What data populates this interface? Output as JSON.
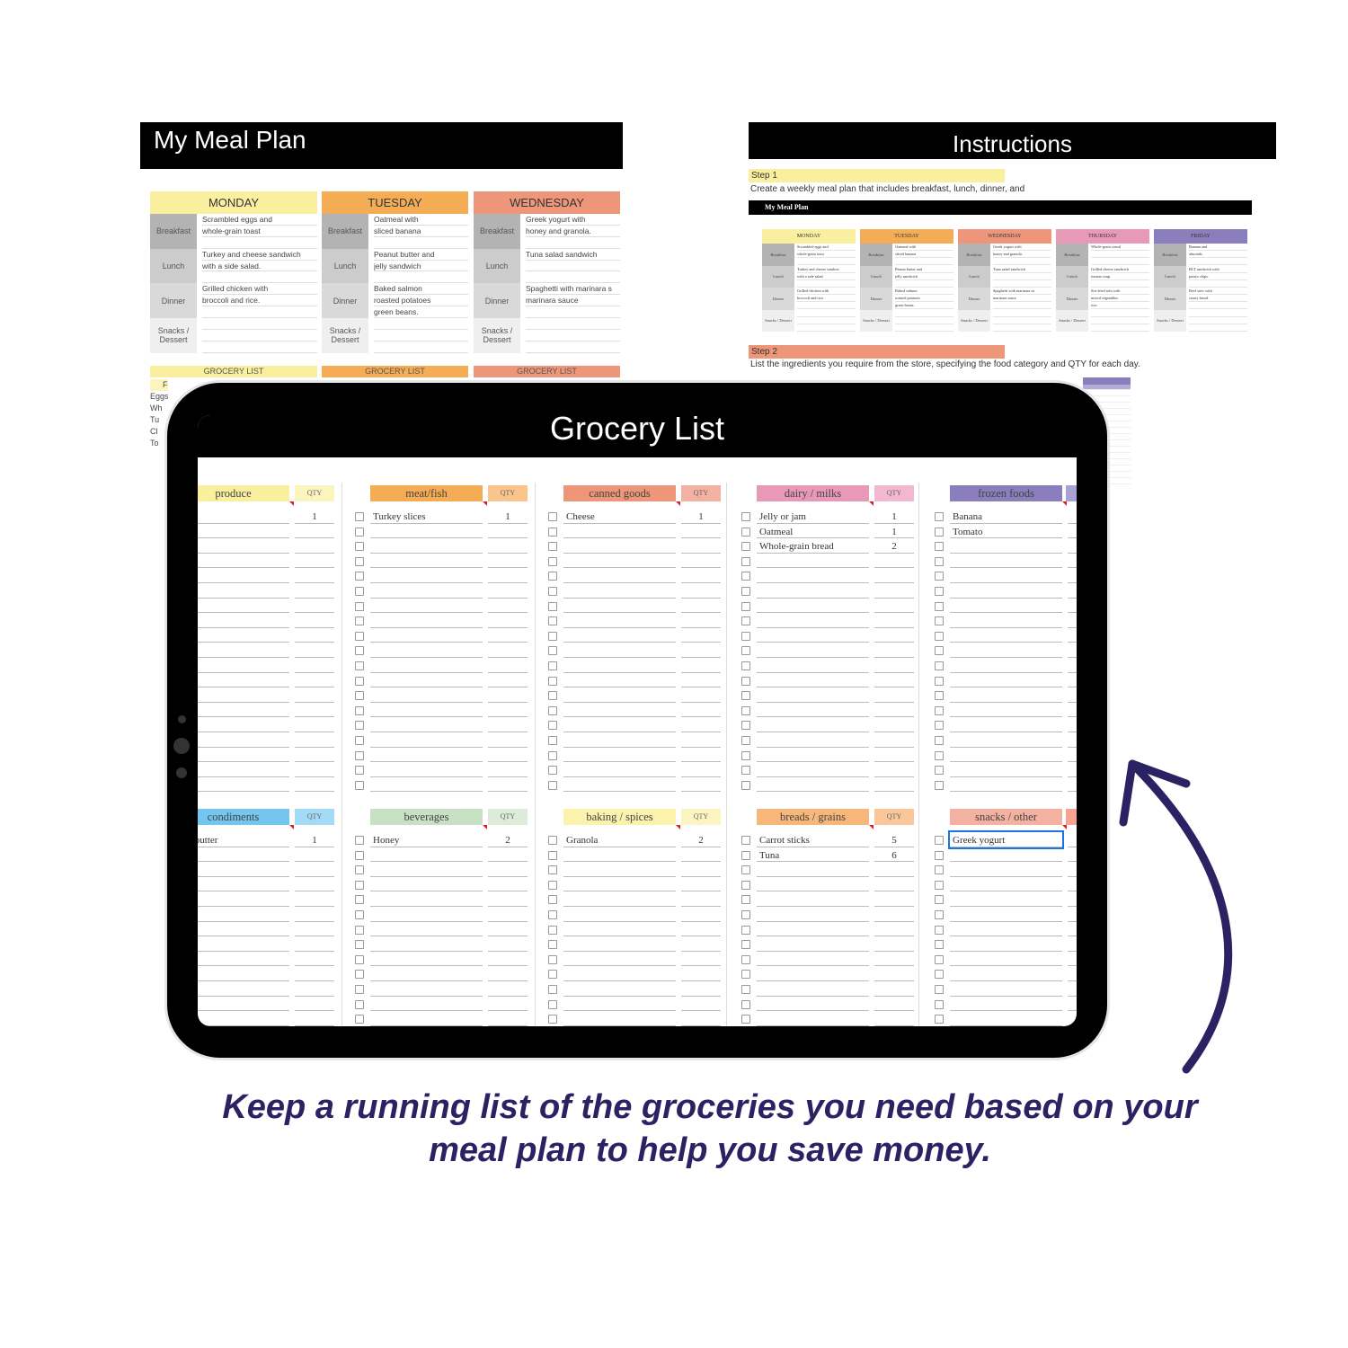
{
  "meal_plan": {
    "title": "My Meal Plan",
    "meal_labels": [
      "Breakfast",
      "Lunch",
      "Dinner",
      "Snacks / Dessert"
    ],
    "grocery_label": "GROCERY LIST",
    "days": [
      {
        "name": "MONDAY",
        "color": "#f9ef9f",
        "meals": [
          [
            "Scrambled eggs and",
            "whole-grain toast",
            ""
          ],
          [
            "Turkey and cheese sandwich",
            "with a side salad.",
            ""
          ],
          [
            "Grilled chicken with",
            "broccoli and rice.",
            ""
          ],
          [
            "",
            "",
            ""
          ]
        ]
      },
      {
        "name": "TUESDAY",
        "color": "#f4ad55",
        "meals": [
          [
            "Oatmeal with",
            "sliced banana",
            ""
          ],
          [
            "Peanut butter and",
            "jelly sandwich",
            ""
          ],
          [
            "Baked salmon",
            "roasted potatoes",
            "green beans."
          ],
          [
            "",
            "",
            ""
          ]
        ]
      },
      {
        "name": "WEDNESDAY",
        "color": "#ed967a",
        "meals": [
          [
            "Greek yogurt with",
            "honey and granola.",
            ""
          ],
          [
            "Tuna salad sandwich",
            "",
            ""
          ],
          [
            "Spaghetti with marinara s",
            "marinara sauce",
            ""
          ],
          [
            "",
            "",
            ""
          ]
        ]
      }
    ],
    "partial_grocery": [
      "FOO",
      "Eggs",
      "Wh",
      "Tu",
      "Cl",
      "To"
    ]
  },
  "instructions": {
    "title": "Instructions",
    "step1_label": "Step 1",
    "step1_text": "Create a weekly meal plan that includes breakfast, lunch, dinner, and",
    "step2_label": "Step 2",
    "step2_text": "List the ingredients you require from the store, specifying the food category and QTY for each day.",
    "mini_title": "My Meal Plan",
    "mini_days": [
      {
        "name": "MONDAY",
        "color": "#f9ef9f",
        "meals": [
          [
            "Scrambled eggs and",
            "whole-grain toast",
            ""
          ],
          [
            "Turkey and cheese sandwic",
            "with a side salad.",
            ""
          ],
          [
            "Grilled chicken with",
            "broccoli and rice.",
            ""
          ],
          [
            "",
            "",
            ""
          ]
        ]
      },
      {
        "name": "TUESDAY",
        "color": "#f4ad55",
        "meals": [
          [
            "Oatmeal with",
            "sliced banana",
            ""
          ],
          [
            "Peanut butter and",
            "jelly sandwich",
            ""
          ],
          [
            "Baked salmon",
            "roasted potatoes",
            "green beans."
          ],
          [
            "",
            "",
            ""
          ]
        ]
      },
      {
        "name": "WEDNESDAY",
        "color": "#ed967a",
        "meals": [
          [
            "Greek yogurt with",
            "honey and granola.",
            ""
          ],
          [
            "Tuna salad sandwich",
            "",
            ""
          ],
          [
            "Spaghetti with marinara sa",
            "marinara sauce",
            ""
          ],
          [
            "",
            "",
            ""
          ]
        ]
      },
      {
        "name": "THURSDAY",
        "color": "#e899b6",
        "meals": [
          [
            "Whole-grain cereal",
            "",
            ""
          ],
          [
            "Grilled cheese sandwich",
            "tomato soup.",
            ""
          ],
          [
            "Stir-fried tofu with",
            "mixed vegetables",
            "rice."
          ],
          [
            "",
            "",
            ""
          ]
        ]
      },
      {
        "name": "FRIDAY",
        "color": "#8a7ebc",
        "meals": [
          [
            "Banana and",
            "almonds.",
            ""
          ],
          [
            "BLT sandwich with",
            "potato chips.",
            ""
          ],
          [
            "Beef stew with",
            "crusty bread.",
            ""
          ],
          [
            "",
            "",
            ""
          ]
        ]
      }
    ]
  },
  "grocery": {
    "title": "Grocery List",
    "qty_label": "QTY",
    "top": [
      {
        "name": "produce",
        "color": "#f9ef9f",
        "qty_color": "#fbf4bd",
        "items": [
          [
            "s",
            "1"
          ]
        ]
      },
      {
        "name": "meat/fish",
        "color": "#f4ad55",
        "qty_color": "#f9c58c",
        "items": [
          [
            "Turkey slices",
            "1"
          ]
        ]
      },
      {
        "name": "canned goods",
        "color": "#ed967a",
        "qty_color": "#f3b1a2",
        "items": [
          [
            "Cheese",
            "1"
          ]
        ]
      },
      {
        "name": "dairy / milks",
        "color": "#e899b6",
        "qty_color": "#f2b8cf",
        "items": [
          [
            "Jelly or jam",
            "1"
          ],
          [
            "Oatmeal",
            "1"
          ],
          [
            "Whole-grain bread",
            "2"
          ]
        ]
      },
      {
        "name": "frozen foods",
        "color": "#8a7ebc",
        "qty_color": "#aaa2d2",
        "items": [
          [
            "Banana",
            ""
          ],
          [
            "Tomato",
            ""
          ]
        ]
      }
    ],
    "bottom": [
      {
        "name": "condiments",
        "color": "#74c6ef",
        "qty_color": "#a3daf5",
        "items": [
          [
            "nut butter",
            "1"
          ]
        ]
      },
      {
        "name": "beverages",
        "color": "#c8e0c4",
        "qty_color": "#dcecd9",
        "items": [
          [
            "Honey",
            "2"
          ]
        ]
      },
      {
        "name": "baking / spices",
        "color": "#fbf2ae",
        "qty_color": "#fcf5c2",
        "items": [
          [
            "Granola",
            "2"
          ]
        ]
      },
      {
        "name": "breads / grains",
        "color": "#f8b77a",
        "qty_color": "#fac79a",
        "items": [
          [
            "Carrot sticks",
            "5"
          ],
          [
            "Tuna",
            "6"
          ]
        ]
      },
      {
        "name": "snacks / other",
        "color": "#f2b1a1",
        "qty_color": "#f5a58f",
        "items": [
          [
            "Greek yogurt",
            ""
          ]
        ]
      }
    ],
    "selected_cell": "Greek yogurt"
  },
  "caption": {
    "line1": "Keep a running list of the groceries you need based on your",
    "line2": "meal plan to help you save money."
  },
  "colors": {
    "arrow": "#2a2262",
    "caption": "#2a2262",
    "label_gray": "#b3b3b3",
    "lunch_gray": "#cccccc",
    "dinner_gray": "#d9d9d9",
    "snack_gray": "#efefef"
  }
}
